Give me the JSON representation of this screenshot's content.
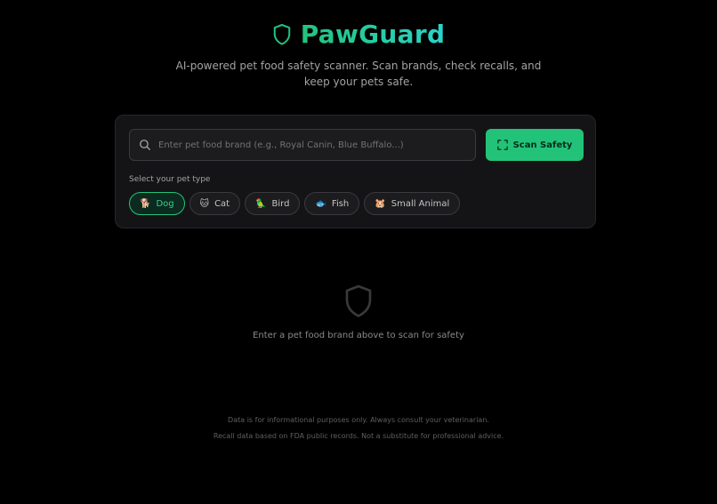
{
  "header": {
    "title": "PawGuard",
    "logo_icon": "shield-icon",
    "tagline_line1": "AI-powered pet food safety scanner. Scan brands, check recalls, and",
    "tagline_line2": "keep your pets safe."
  },
  "search": {
    "placeholder": "Enter pet food brand (e.g., Royal Canin, Blue Buffalo...)",
    "value": "",
    "icon": "search-icon"
  },
  "scan_button": {
    "label": "Scan Safety",
    "icon": "scan-frame-icon"
  },
  "pet_selector": {
    "label": "Select your pet type",
    "selected": "Dog",
    "options": [
      {
        "emoji": "🐕",
        "label": "Dog"
      },
      {
        "emoji": "🐱",
        "label": "Cat"
      },
      {
        "emoji": "🦜",
        "label": "Bird"
      },
      {
        "emoji": "🐟",
        "label": "Fish"
      },
      {
        "emoji": "🐹",
        "label": "Small Animal"
      }
    ]
  },
  "empty_state": {
    "icon": "shield-outline-icon",
    "text": "Enter a pet food brand above to scan for safety"
  },
  "footer": {
    "line1": "Data is for informational purposes only. Always consult your veterinarian.",
    "line2": "Recall data based on FDA public records. Not a substitute for professional advice."
  },
  "colors": {
    "background": "#000000",
    "accent": "#22c379",
    "accent_text": "#2ed48c",
    "card": "#141416"
  }
}
